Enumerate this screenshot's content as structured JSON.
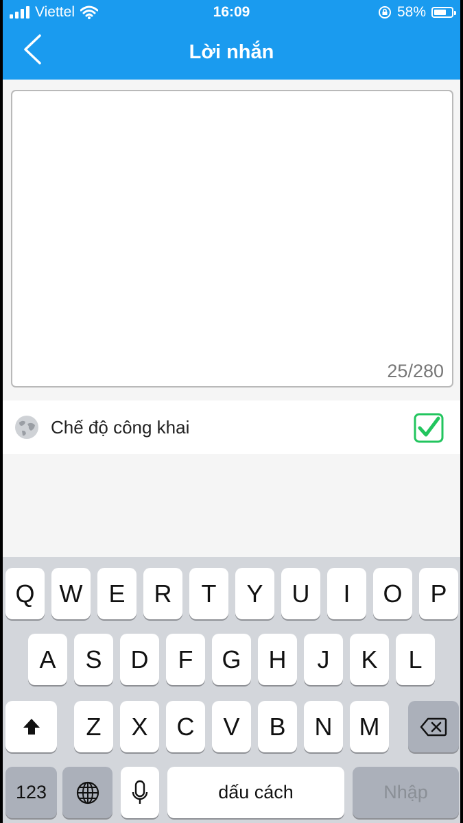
{
  "status_bar": {
    "carrier": "Viettel",
    "time": "16:09",
    "battery": "58%",
    "battery_level": 0.58
  },
  "header": {
    "title": "Lời nhắn",
    "back_icon": "chevron-left-icon"
  },
  "message": {
    "value": "",
    "counter": "25/280"
  },
  "public_mode": {
    "label": "Chế độ công khai",
    "icon": "globe-icon",
    "checked": true,
    "check_color": "#22c55e"
  },
  "keyboard": {
    "row1": [
      "Q",
      "W",
      "E",
      "R",
      "T",
      "Y",
      "U",
      "I",
      "O",
      "P"
    ],
    "row2": [
      "A",
      "S",
      "D",
      "F",
      "G",
      "H",
      "J",
      "K",
      "L"
    ],
    "row3": [
      "Z",
      "X",
      "C",
      "V",
      "B",
      "N",
      "M"
    ],
    "numbers_key": "123",
    "space_key": "dấu cách",
    "enter_key": "Nhập",
    "shift_icon": "shift-icon",
    "backspace_icon": "backspace-icon",
    "globe_icon": "globe-icon",
    "mic_icon": "microphone-icon"
  },
  "colors": {
    "header_bg": "#1a9bef",
    "accent_check": "#22c55e"
  }
}
